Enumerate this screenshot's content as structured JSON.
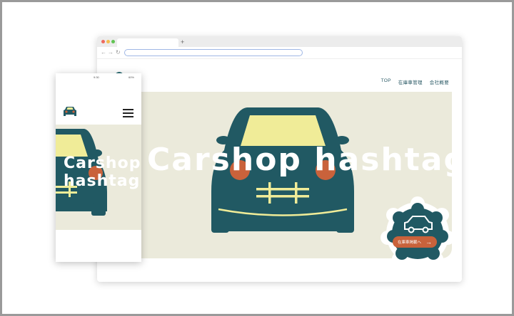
{
  "colors": {
    "car_body": "#215963",
    "windshield": "#f0ec98",
    "headlight": "#c9623b",
    "grille": "#f0ec98",
    "hero_bg": "#ebeadb",
    "button": "#c9623b",
    "nav_text": "#2b5a66"
  },
  "browser": {
    "new_tab_symbol": "+",
    "nav": [
      "TOP",
      "在庫車管理",
      "会社概要"
    ],
    "hero_title": "Carshop hashtag",
    "badge_button_label": "在庫車掲載へ",
    "badge_icon": "car-icon"
  },
  "phone": {
    "status_time": "9:30",
    "status_battery": "60%",
    "hero_title_line1": "Carshop",
    "hero_title_line2": "hashtag",
    "logo_icon": "car-logo-icon",
    "menu_icon": "hamburger-menu-icon"
  }
}
